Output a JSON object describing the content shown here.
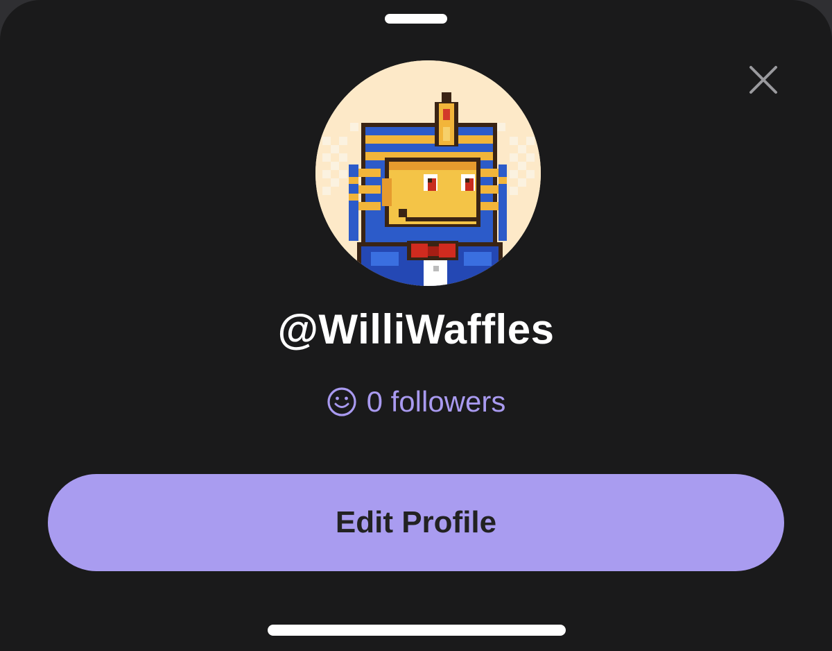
{
  "profile": {
    "username": "@WilliWaffles",
    "followers_count_text": "0 followers",
    "avatar_icon": "pixel-monkey-pharaoh-avatar"
  },
  "actions": {
    "edit_profile_label": "Edit Profile"
  },
  "icons": {
    "close": "close-icon",
    "followers": "smiley-icon",
    "grabber": "sheet-grabber",
    "home": "home-indicator"
  },
  "colors": {
    "sheet_background": "#1a1a1b",
    "accent": "#a99cf0",
    "followers_text": "#a99af0",
    "text_primary": "#ffffff",
    "button_text": "#222222"
  }
}
